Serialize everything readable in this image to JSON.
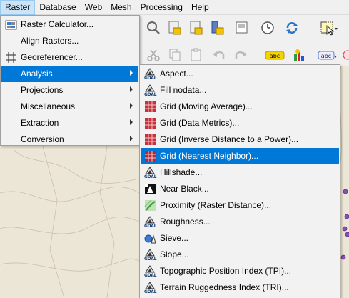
{
  "menubar": {
    "items": [
      {
        "label": "Raster",
        "key": "R",
        "rest": "aster"
      },
      {
        "label": "Database",
        "key": "D",
        "rest": "atabase"
      },
      {
        "label": "Web",
        "key": "W",
        "rest": "eb"
      },
      {
        "label": "Mesh",
        "key": "M",
        "rest": "esh"
      },
      {
        "label": "Processing",
        "key": "o",
        "pre": "Pr",
        "rest": "cessing"
      },
      {
        "label": "Help",
        "key": "H",
        "rest": "elp"
      }
    ]
  },
  "raster_menu": {
    "items": [
      {
        "label": "Raster Calculator...",
        "icon": "raster-calculator-icon"
      },
      {
        "label": "Align Rasters...",
        "icon": ""
      },
      {
        "label": "Georeferencer...",
        "icon": "georeferencer-grid-icon"
      },
      {
        "label": "Analysis",
        "submenu": true,
        "highlighted": true
      },
      {
        "label": "Projections",
        "submenu": true
      },
      {
        "label": "Miscellaneous",
        "submenu": true
      },
      {
        "label": "Extraction",
        "submenu": true
      },
      {
        "label": "Conversion",
        "submenu": true
      }
    ]
  },
  "analysis_menu": {
    "items": [
      {
        "label": "Aspect...",
        "icon": "gdal-icon"
      },
      {
        "label": "Fill nodata...",
        "icon": "gdal-icon"
      },
      {
        "label": "Grid (Moving Average)...",
        "icon": "grid-icon"
      },
      {
        "label": "Grid (Data Metrics)...",
        "icon": "grid-icon"
      },
      {
        "label": "Grid (Inverse Distance to a Power)...",
        "icon": "grid-icon"
      },
      {
        "label": "Grid (Nearest Neighbor)...",
        "icon": "grid-icon",
        "highlighted": true
      },
      {
        "label": "Hillshade...",
        "icon": "gdal-icon"
      },
      {
        "label": "Near Black...",
        "icon": "near-black-icon"
      },
      {
        "label": "Proximity (Raster Distance)...",
        "icon": "proximity-icon"
      },
      {
        "label": "Roughness...",
        "icon": "gdal-icon"
      },
      {
        "label": "Sieve...",
        "icon": "sieve-icon"
      },
      {
        "label": "Slope...",
        "icon": "gdal-icon"
      },
      {
        "label": "Topographic Position Index (TPI)...",
        "icon": "gdal-icon"
      },
      {
        "label": "Terrain Ruggedness Index (TRI)...",
        "icon": "gdal-icon"
      }
    ]
  },
  "gdal_text": "GDAL",
  "toolbar": {
    "label_abc": "abc"
  },
  "colors": {
    "highlight": "#0078d7",
    "menu_bg": "#f2f2f2",
    "map_bg": "#ece6d6"
  }
}
